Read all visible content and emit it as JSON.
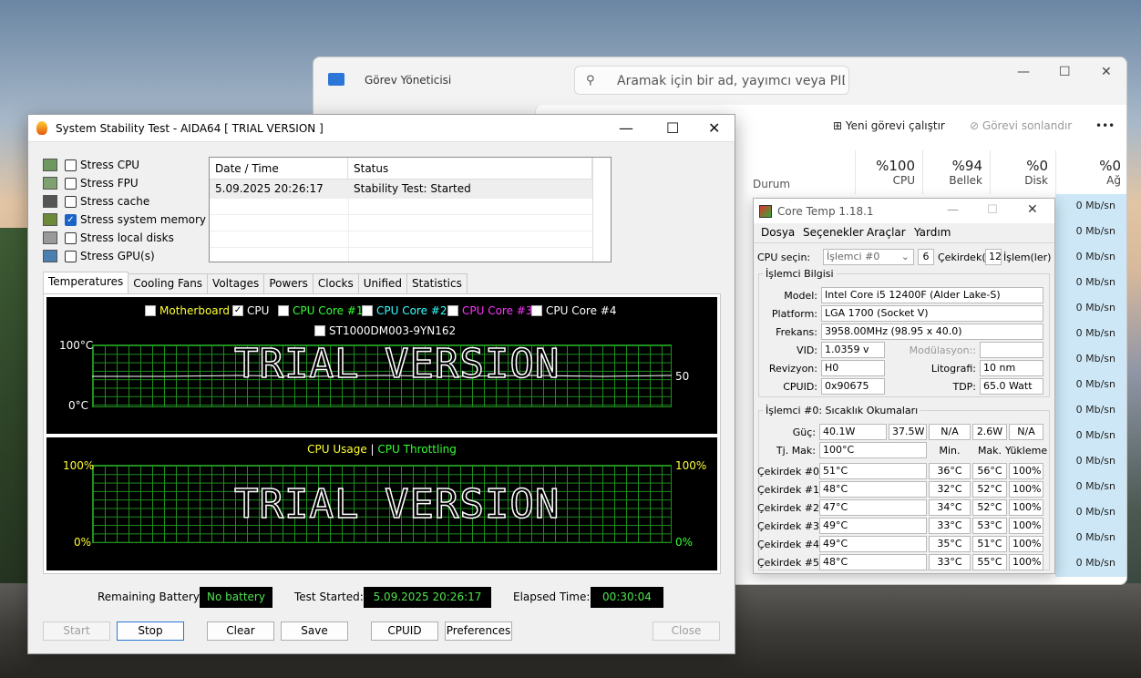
{
  "task_manager": {
    "title": "Görev Yöneticisi",
    "search_placeholder": "Aramak için bir ad, yayımcı veya PID g...",
    "run_new_task": "Yeni görevi çalıştır",
    "end_task": "Görevi sonlandır",
    "columns": [
      {
        "pct": "%100",
        "label": "CPU"
      },
      {
        "pct": "%94",
        "label": "Bellek"
      },
      {
        "pct": "%0",
        "label": "Disk"
      },
      {
        "pct": "%0",
        "label": "Ağ"
      }
    ],
    "status_column": "Durum",
    "net_values": [
      "0 Mb/sn",
      "0 Mb/sn",
      "0 Mb/sn",
      "0 Mb/sn",
      "0 Mb/sn",
      "0 Mb/sn",
      "0 Mb/sn",
      "0 Mb/sn",
      "0 Mb/sn",
      "0 Mb/sn",
      "0 Mb/sn",
      "0 Mb/sn",
      "0 Mb/sn",
      "0 Mb/sn",
      "0 Mb/sn"
    ]
  },
  "aida": {
    "title": "System Stability Test - AIDA64  [ TRIAL VERSION ]",
    "stress_options": [
      {
        "label": "Stress CPU",
        "checked": false,
        "icon": "cpu-chip-icon"
      },
      {
        "label": "Stress FPU",
        "checked": false,
        "icon": "fpu-icon"
      },
      {
        "label": "Stress cache",
        "checked": false,
        "icon": "cache-icon"
      },
      {
        "label": "Stress system memory",
        "checked": true,
        "icon": "memory-icon"
      },
      {
        "label": "Stress local disks",
        "checked": false,
        "icon": "disk-icon"
      },
      {
        "label": "Stress GPU(s)",
        "checked": false,
        "icon": "gpu-icon"
      }
    ],
    "log_headers": [
      "Date / Time",
      "Status"
    ],
    "log_rows": [
      {
        "time": "5.09.2025 20:26:17",
        "status": "Stability Test: Started"
      }
    ],
    "tabs": [
      "Temperatures",
      "Cooling Fans",
      "Voltages",
      "Powers",
      "Clocks",
      "Unified",
      "Statistics"
    ],
    "temp_graph": {
      "checks": [
        {
          "label": "Motherboard",
          "checked": false,
          "color": "#ffff33"
        },
        {
          "label": "CPU",
          "checked": true,
          "color": "#ffffff"
        },
        {
          "label": "CPU Core #1",
          "checked": false,
          "color": "#33ff33"
        },
        {
          "label": "CPU Core #2",
          "checked": false,
          "color": "#33ffff"
        },
        {
          "label": "CPU Core #3",
          "checked": false,
          "color": "#ff33ff"
        },
        {
          "label": "CPU Core #4",
          "checked": false,
          "color": "#ffffff"
        },
        {
          "label": "ST1000DM003-9YN162",
          "checked": false,
          "color": "#ffffff"
        }
      ],
      "y_top": "100°C",
      "y_bottom": "0°C",
      "current_value": "50",
      "watermark": "TRIAL VERSION"
    },
    "usage_graph": {
      "legend_a": "CPU Usage",
      "separator": "|",
      "legend_b": "CPU Throttling",
      "y_top_left": "100%",
      "y_bottom_left": "0%",
      "y_top_right": "100%",
      "y_bottom_right": "0%",
      "watermark": "TRIAL VERSION"
    },
    "status": {
      "battery_label": "Remaining Battery:",
      "battery_value": "No battery",
      "started_label": "Test Started:",
      "started_value": "5.09.2025 20:26:17",
      "elapsed_label": "Elapsed Time:",
      "elapsed_value": "00:30:04"
    },
    "buttons": {
      "start": "Start",
      "stop": "Stop",
      "clear": "Clear",
      "save": "Save",
      "cpuid": "CPUID",
      "preferences": "Preferences",
      "close": "Close"
    }
  },
  "coretemp": {
    "title": "Core Temp 1.18.1",
    "menu": [
      "Dosya",
      "Seçenekler",
      "Araçlar",
      "Yardım"
    ],
    "cpu_select_label": "CPU seçin:",
    "cpu_select_value": "İşlemci #0",
    "cores_value": "6",
    "cores_label": "Çekirdek(le",
    "threads_value": "12",
    "threads_label": "İşlem(ler)",
    "info_group": "İşlemci Bilgisi",
    "model_label": "Model:",
    "model": "Intel Core i5 12400F (Alder Lake-S)",
    "platform_label": "Platform:",
    "platform": "LGA 1700 (Socket V)",
    "freq_label": "Frekans:",
    "freq": "3958.00MHz (98.95 x 40.0)",
    "vid_label": "VID:",
    "vid": "1.0359 v",
    "modulation_label": "Modülasyon::",
    "modulation": "",
    "revision_label": "Revizyon:",
    "revision": "H0",
    "litho_label": "Litografi:",
    "litho": "10 nm",
    "cpuid_label": "CPUID:",
    "cpuid": "0x90675",
    "tdp_label": "TDP:",
    "tdp": "65.0 Watt",
    "temps_group": "İşlemci #0: Sıcaklık Okumaları",
    "power_label": "Güç:",
    "power_values": [
      "40.1W",
      "37.5W",
      "N/A",
      "2.6W",
      "N/A"
    ],
    "tjmax_label": "Tj. Mak:",
    "tjmax": "100°C",
    "col_min": "Min.",
    "col_max": "Mak.",
    "col_load": "Yükleme",
    "cores": [
      {
        "name": "Çekirdek #0:",
        "temp": "51°C",
        "min": "36°C",
        "max": "56°C",
        "load": "100%"
      },
      {
        "name": "Çekirdek #1:",
        "temp": "48°C",
        "min": "32°C",
        "max": "52°C",
        "load": "100%"
      },
      {
        "name": "Çekirdek #2:",
        "temp": "47°C",
        "min": "34°C",
        "max": "52°C",
        "load": "100%"
      },
      {
        "name": "Çekirdek #3:",
        "temp": "49°C",
        "min": "33°C",
        "max": "53°C",
        "load": "100%"
      },
      {
        "name": "Çekirdek #4:",
        "temp": "49°C",
        "min": "35°C",
        "max": "51°C",
        "load": "100%"
      },
      {
        "name": "Çekirdek #5:",
        "temp": "48°C",
        "min": "33°C",
        "max": "55°C",
        "load": "100%"
      }
    ]
  }
}
